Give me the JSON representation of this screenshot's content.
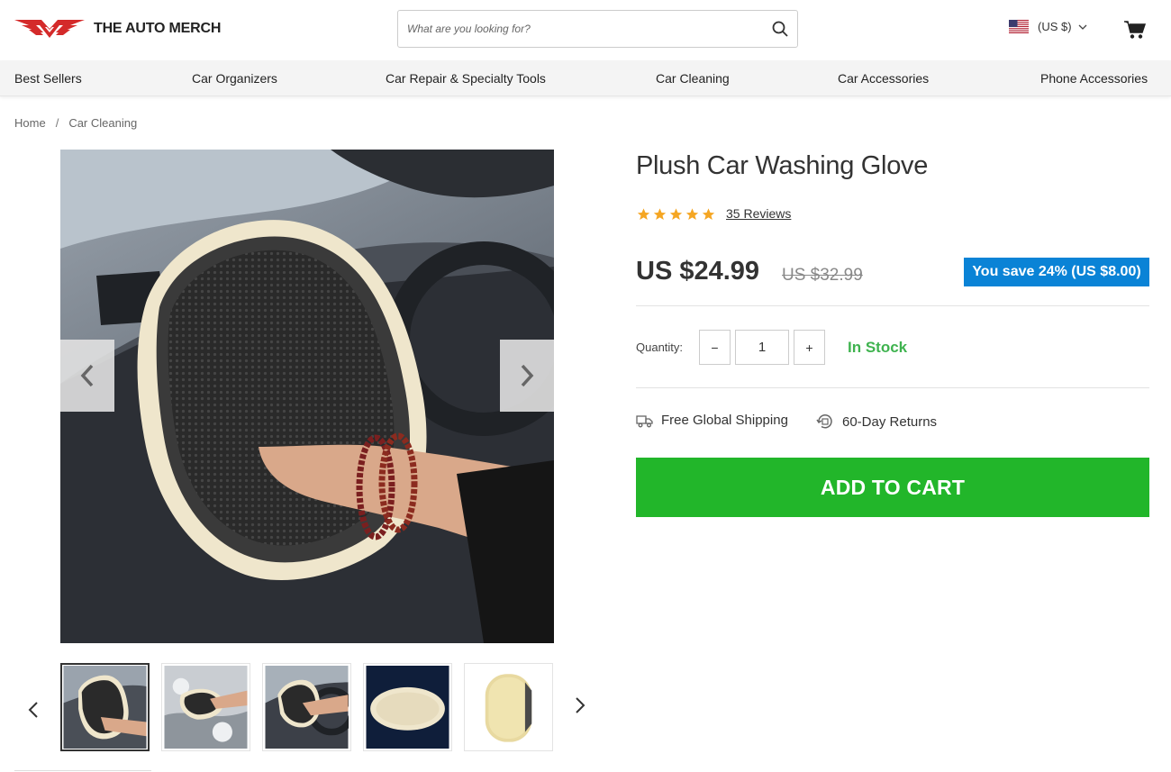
{
  "header": {
    "brand": "THE AUTO MERCH",
    "search_placeholder": "What are you looking for?",
    "currency": "(US $)",
    "brand_color": "#d42a2a"
  },
  "nav": {
    "items": [
      {
        "label": "Best Sellers"
      },
      {
        "label": "Car Organizers"
      },
      {
        "label": "Car Repair & Specialty Tools"
      },
      {
        "label": "Car Cleaning"
      },
      {
        "label": "Car Accessories"
      },
      {
        "label": "Phone Accessories"
      }
    ]
  },
  "breadcrumb": {
    "home": "Home",
    "separator": "/",
    "current": "Car Cleaning"
  },
  "product": {
    "title": "Plush Car Washing Glove",
    "rating": 5,
    "reviews": "35 Reviews",
    "price": "US $24.99",
    "old_price": "US $32.99",
    "savings": "You save 24% (US $8.00)",
    "quantity_label": "Quantity:",
    "quantity_value": "1",
    "qty_minus": "−",
    "qty_plus": "+",
    "stock": "In Stock",
    "shipping": "Free Global Shipping",
    "returns": "60-Day Returns",
    "add_to_cart": "ADD TO CART"
  },
  "colors": {
    "save_badge": "#0a83d6",
    "in_stock": "#3fb34f",
    "add_to_cart": "#22b62a",
    "star": "#f5a623"
  },
  "gallery": {
    "thumbnail_count": 5,
    "active_index": 0
  }
}
